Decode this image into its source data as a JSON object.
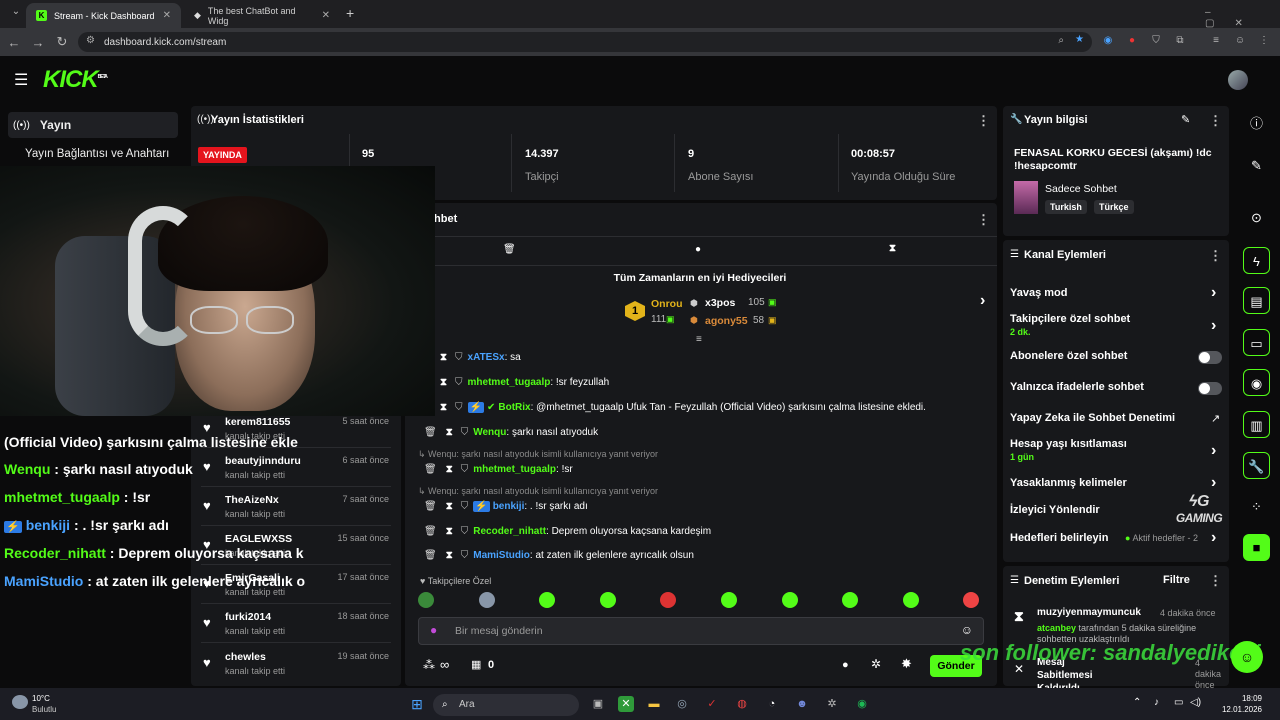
{
  "browser": {
    "tabs": [
      {
        "title": "Stream - Kick Dashboard"
      },
      {
        "title": "The best ChatBot and Widg"
      }
    ],
    "url": "dashboard.kick.com/stream"
  },
  "header": {
    "logo": "KICK",
    "logo_badge": "BETA"
  },
  "sidebar": {
    "section": "Yayın",
    "item": "Yayın Bağlantısı ve Anahtarı"
  },
  "stats": {
    "title": "Yayın İstatistikleri",
    "live_badge": "YAYINDA",
    "items": [
      {
        "value": "95",
        "label": ""
      },
      {
        "value": "14.397",
        "label": "Takipçi"
      },
      {
        "value": "9",
        "label": "Abone Sayısı"
      },
      {
        "value": "00:08:57",
        "label": "Yayında Olduğu Süre"
      }
    ]
  },
  "overlay_chat": [
    {
      "user": "",
      "text": "(Official Video) şarkısını çalma listesine ekle"
    },
    {
      "user": "Wenqu",
      "text": " : şarkı nasıl atıyoduk",
      "color": "#53fc18"
    },
    {
      "user": "mhetmet_tugaalp",
      "text": " : !sr",
      "color": "#53fc18"
    },
    {
      "user": "benkiji",
      "text": " : . !sr şarkı adı",
      "color": "#4aa3ff"
    },
    {
      "user": "Recoder_nihatt",
      "text": " : Deprem oluyorsa kaçsana k",
      "color": "#53fc18"
    },
    {
      "user": "MamiStudio",
      "text": " : at zaten ilk gelenlere ayrıcalık o",
      "color": "#4aa3ff"
    }
  ],
  "followers": [
    {
      "name": "kerem811655",
      "sub": "kanalı takip etti",
      "time": "5 saat önce"
    },
    {
      "name": "beautyjinnduru",
      "sub": "kanalı takip etti",
      "time": "6 saat önce"
    },
    {
      "name": "TheAizeNx",
      "sub": "kanalı takip etti",
      "time": "7 saat önce"
    },
    {
      "name": "EAGLEWXSS",
      "sub": "kanalı takip etti",
      "time": "15 saat önce"
    },
    {
      "name": "EmirGasali",
      "sub": "kanalı takip etti",
      "time": "17 saat önce"
    },
    {
      "name": "furki2014",
      "sub": "kanalı takip etti",
      "time": "18 saat önce"
    },
    {
      "name": "chewles",
      "sub": "kanalı takip etti",
      "time": "19 saat önce"
    }
  ],
  "chat": {
    "title": "Sohbet",
    "gifters_title": "Tüm Zamanların en iyi Hediyecileri",
    "gifters": [
      {
        "name": "Onrou",
        "count": "111"
      },
      {
        "name": "x3pos",
        "count": "105"
      },
      {
        "name": "agony55",
        "count": "58"
      }
    ],
    "messages": [
      {
        "user": "xATESx",
        "text": ": sa",
        "color": "#4aa3ff"
      },
      {
        "user": "mhetmet_tugaalp",
        "text": ": !sr feyzullah",
        "color": "#53fc18"
      },
      {
        "user": "BotRix",
        "text": ": @mhetmet_tugaalp Ufuk Tan - Feyzullah (Official Video) şarkısını çalma listesine ekledi.",
        "color": "#53fc18"
      },
      {
        "user": "Wenqu",
        "text": ": şarkı nasıl atıyoduk",
        "color": "#53fc18"
      },
      {
        "reply": "Wenqu: şarkı nasıl atıyoduk isimli kullanıcıya yanıt veriyor"
      },
      {
        "user": "mhetmet_tugaalp",
        "text": ": !sr",
        "color": "#53fc18"
      },
      {
        "reply": "Wenqu: şarkı nasıl atıyoduk isimli kullanıcıya yanıt veriyor"
      },
      {
        "user": "benkiji",
        "text": ": . !sr şarkı adı",
        "color": "#4aa3ff"
      },
      {
        "user": "Recoder_nihatt",
        "text": ": Deprem oluyorsa kaçsana kardeşim",
        "color": "#53fc18"
      },
      {
        "user": "MamiStudio",
        "text": ": at zaten ilk gelenlere ayrıcalık olsun",
        "color": "#4aa3ff"
      }
    ],
    "followers_only": "Takipçilere Özel",
    "placeholder": "Bir mesaj gönderin",
    "infinite": "∞",
    "count": "0",
    "send": "Gönder"
  },
  "stream_info": {
    "title": "Yayın bilgisi",
    "stream_title": "FENASAL KORKU GECESİ (akşamı) !dc !hesapcomtr",
    "category": "Sadece Sohbet",
    "tags": [
      "Turkish",
      "Türkçe"
    ]
  },
  "channel_actions": {
    "title": "Kanal Eylemleri",
    "items": [
      {
        "label": "Yavaş mod",
        "sub": "",
        "control": "chevron"
      },
      {
        "label": "Takipçilere özel sohbet",
        "sub": "2 dk.",
        "control": "chevron"
      },
      {
        "label": "Abonelere özel sohbet",
        "sub": "",
        "control": "toggle"
      },
      {
        "label": "Yalnızca ifadelerle sohbet",
        "sub": "",
        "control": "toggle"
      },
      {
        "label": "Yapay Zeka ile Sohbet Denetimi",
        "sub": "",
        "control": "external"
      },
      {
        "label": "Hesap yaşı kısıtlaması",
        "sub": "1 gün",
        "control": "chevron"
      },
      {
        "label": "Yasaklanmış kelimeler",
        "sub": "",
        "control": "chevron"
      },
      {
        "label": "İzleyici Yönlendir",
        "sub": "",
        "control": "none"
      },
      {
        "label": "Hedefleri belirleyin",
        "sub": "",
        "control": "chevron",
        "badge": "Aktif hedefler - 2"
      }
    ]
  },
  "moderation": {
    "title": "Denetim Eylemleri",
    "filter": "Filtre",
    "items": [
      {
        "user": "muzyiyenmaymuncuk",
        "time": "4 dakika önce",
        "actor": "atcanbey",
        "text": " tarafından 5 dakika süreliğine sohbetten uzaklaştırıldı"
      },
      {
        "user": "Mesaj Sabitlemesi Kaldırıldı",
        "time": "4 dakika önce"
      }
    ]
  },
  "overlay_text": {
    "watermark": "son follower: sandalyedikeni",
    "gaming": "GAMING"
  },
  "taskbar": {
    "weather_temp": "10°C",
    "weather_desc": "Bulutlu",
    "search": "Ara",
    "time": "18:09",
    "date": "12.01.2026"
  }
}
